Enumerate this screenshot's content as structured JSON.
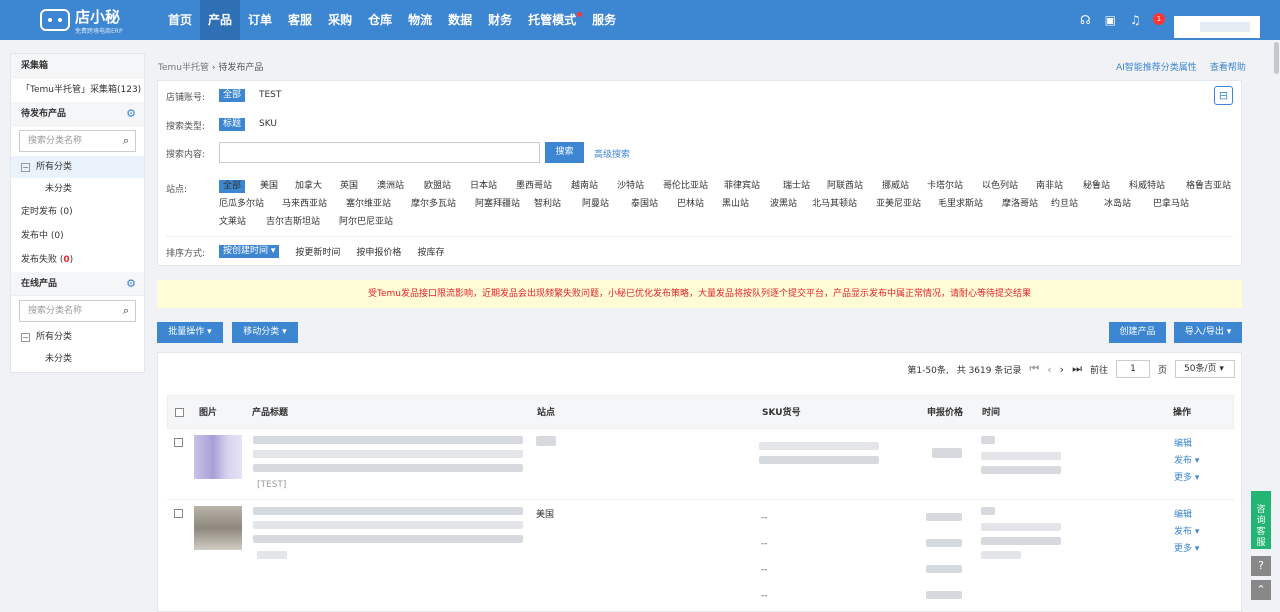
{
  "brand": {
    "name": "店小秘",
    "subtitle": "免费跨境电商ERP"
  },
  "nav": [
    {
      "label": "首页"
    },
    {
      "label": "产品"
    },
    {
      "label": "订单"
    },
    {
      "label": "客服"
    },
    {
      "label": "采购"
    },
    {
      "label": "仓库"
    },
    {
      "label": "物流"
    },
    {
      "label": "数据"
    },
    {
      "label": "财务"
    },
    {
      "label": "托管模式"
    },
    {
      "label": "服务"
    }
  ],
  "header": {
    "notification_count": "1"
  },
  "sidebar": {
    "collect_title": "采集箱",
    "collect_item": "「Temu半托管」采集箱(123)",
    "pending_title": "待发布产品",
    "search_placeholder": "搜索分类名称",
    "all_category": "所有分类",
    "uncategorized": "未分类",
    "scheduled": "定时发布 (0)",
    "publishing": "发布中 (0)",
    "failed_label": "发布失败 (",
    "failed_count": "0",
    "failed_close": ")",
    "online_title": "在线产品"
  },
  "breadcrumb": {
    "root": "Temu半托管",
    "sep": "›",
    "current": "待发布产品"
  },
  "top_links": {
    "ai": "AI智能推荐分类属性",
    "help": "查看帮助"
  },
  "filter": {
    "shop_label": "店铺账号:",
    "shop_all": "全部",
    "shop_value": "TEST",
    "type_label": "搜索类型:",
    "type_selected": "标题",
    "type_other": "SKU",
    "content_label": "搜索内容:",
    "search_btn": "搜索",
    "advanced": "高级搜索",
    "site_label": "站点:",
    "sites_row1": [
      "全部",
      "美国",
      "加拿大",
      "英国",
      "澳洲站",
      "欧盟站",
      "日本站",
      "墨西哥站",
      "越南站",
      "沙特站",
      "哥伦比亚站",
      "菲律宾站",
      "瑞士站",
      "阿联酋站",
      "挪威站",
      "卡塔尔站",
      "以色列站",
      "南非站",
      "秘鲁站",
      "科威特站",
      "格鲁吉亚站"
    ],
    "sites_row2": [
      "厄瓜多尔站",
      "马来西亚站",
      "塞尔维亚站",
      "摩尔多瓦站",
      "阿塞拜疆站",
      "智利站",
      "阿曼站",
      "泰国站",
      "巴林站",
      "黑山站",
      "波黑站",
      "北马其顿站",
      "亚美尼亚站",
      "毛里求斯站",
      "摩洛哥站",
      "约旦站",
      "冰岛站",
      "巴拿马站"
    ],
    "sites_row3": [
      "文莱站",
      "吉尔吉斯坦站",
      "阿尔巴尼亚站"
    ],
    "sort_label": "排序方式:",
    "sort_selected": "按创建时间",
    "sort_options": [
      "按更新时间",
      "按申报价格",
      "按库存"
    ]
  },
  "notice": "受Temu发品接口限流影响，近期发品会出现频繁失败问题，小秘已优化发布策略，大量发品将按队列逐个提交平台，产品显示发布中属正常情况，请耐心等待提交结果",
  "actions": {
    "batch": "批量操作",
    "move": "移动分类",
    "create": "创建产品",
    "import_export": "导入/导出"
  },
  "pager": {
    "range": "第1-50条,",
    "total": "共 3619 条记录",
    "goto": "前往",
    "page": "1",
    "page_unit": "页",
    "per_page": "50条/页"
  },
  "table": {
    "columns": {
      "image": "图片",
      "title": "产品标题",
      "site": "站点",
      "sku": "SKU货号",
      "price": "申报价格",
      "time": "时间",
      "ops": "操作"
    },
    "rows": [
      {
        "shop_tag": "[TEST]",
        "ops": [
          "编辑",
          "发布",
          "更多"
        ]
      },
      {
        "site": "美国",
        "sku_values": [
          "--",
          "--",
          "--",
          "--"
        ],
        "ops": [
          "编辑",
          "发布",
          "更多"
        ]
      }
    ]
  },
  "float": {
    "consult": "咨询客服",
    "help_icon": "?"
  }
}
